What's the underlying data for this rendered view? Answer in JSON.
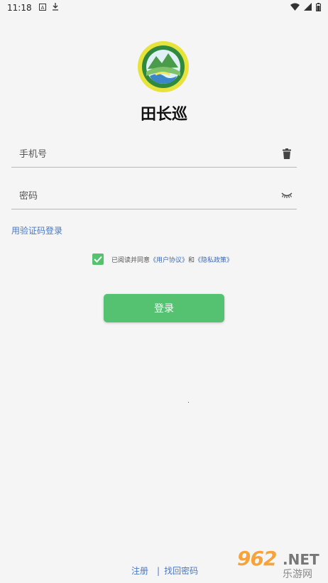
{
  "status_bar": {
    "time": "11:18",
    "icons": [
      "a-icon",
      "download-icon",
      "wifi-icon",
      "signal-icon",
      "battery-icon"
    ]
  },
  "app": {
    "title": "田长巡"
  },
  "phone": {
    "placeholder": "手机号"
  },
  "password": {
    "placeholder": "密码"
  },
  "sms_login": "用验证码登录",
  "agreement": {
    "prefix": "已阅读并同意",
    "user_agreement": "《用户协议》",
    "and": "和",
    "privacy_policy": "《隐私政策》",
    "checked": true
  },
  "login_button": "登录",
  "footer": {
    "register": "注册",
    "separator": "|",
    "forgot_password": "找回密码"
  },
  "watermark": {
    "number": "962",
    "net": ".NET",
    "cn": "乐游网"
  },
  "colors": {
    "accent": "#55c272",
    "link": "#4a78c2",
    "background": "#f5f5f5"
  }
}
